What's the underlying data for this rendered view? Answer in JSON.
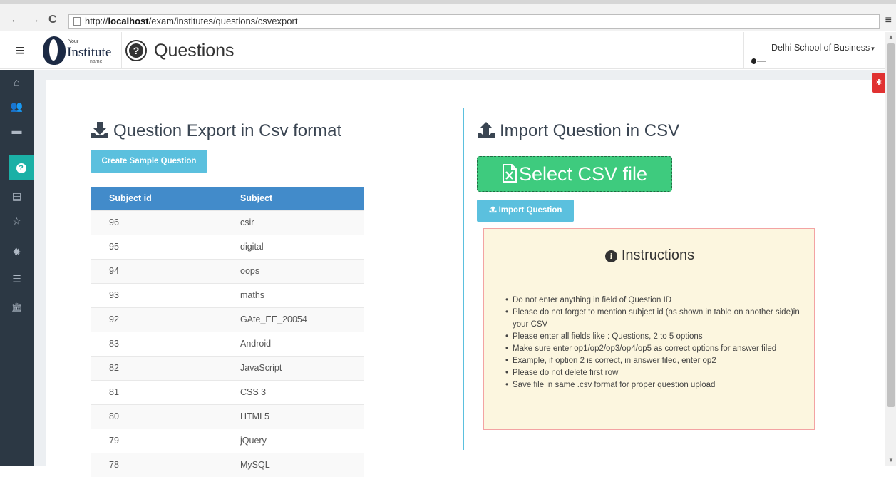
{
  "browser": {
    "back": "←",
    "forward": "→",
    "reload": "C",
    "url_prefix": "http://",
    "url_host": "localhost",
    "url_path": "/exam/institutes/questions/csvexport",
    "menu": "≡"
  },
  "header": {
    "menu_icon": "≡",
    "logo_your": "Your",
    "logo_name": "Institute",
    "logo_sub": "name",
    "title_icon": "?",
    "title": "Questions",
    "school": "Delhi School of Business",
    "school_caret": "▾"
  },
  "sidebar": {
    "items": [
      {
        "icon": "home-icon",
        "glyph": "⌂"
      },
      {
        "icon": "users-icon",
        "glyph": "👥"
      },
      {
        "icon": "window-icon",
        "glyph": "▬"
      },
      {
        "icon": "question-icon",
        "glyph": "?",
        "active": true
      },
      {
        "icon": "document-icon",
        "glyph": "▤"
      },
      {
        "icon": "star-icon",
        "glyph": "☆"
      },
      {
        "icon": "gear-icon",
        "glyph": "✹"
      },
      {
        "icon": "list-icon",
        "glyph": "☰"
      },
      {
        "icon": "bank-icon",
        "glyph": "🏛"
      }
    ]
  },
  "export": {
    "title": "Question Export in Csv format",
    "create_sample_label": "Create Sample Question",
    "table": {
      "columns": [
        "Subject id",
        "Subject"
      ],
      "rows": [
        [
          "96",
          "csir"
        ],
        [
          "95",
          "digital"
        ],
        [
          "94",
          "oops"
        ],
        [
          "93",
          "maths"
        ],
        [
          "92",
          "GAte_EE_20054"
        ],
        [
          "83",
          "Android"
        ],
        [
          "82",
          "JavaScript"
        ],
        [
          "81",
          "CSS 3"
        ],
        [
          "80",
          "HTML5"
        ],
        [
          "79",
          "jQuery"
        ],
        [
          "78",
          "MySQL"
        ]
      ]
    }
  },
  "import": {
    "title": "Import Question in CSV",
    "select_label": "Select CSV file",
    "import_label": "Import Question",
    "instructions": {
      "title": "Instructions",
      "info_glyph": "i",
      "items": [
        "Do not enter anything in field of Question ID",
        "Please do not forget to mention subject id (as shown in table on another side)in your CSV",
        "Please enter all fields like : Questions, 2 to 5 options",
        "Make sure enter op1/op2/op3/op4/op5 as correct options for answer filed",
        "Example, if option 2 is correct, in answer filed, enter op2",
        "Please do not delete first row",
        "Save file in same .csv format for proper question upload"
      ]
    }
  },
  "colors": {
    "sidebar_bg": "#2c3844",
    "sidebar_active": "#1bb0a6",
    "table_header": "#428bca",
    "info_button": "#5bc0de",
    "select_button": "#3ecb7e",
    "instructions_bg": "#fcf6df",
    "instructions_border": "#f3a3a3",
    "bug_button": "#e03131"
  },
  "misc": {
    "bug_glyph": "✱",
    "scroll_up": "▲",
    "scroll_down": "▼"
  }
}
